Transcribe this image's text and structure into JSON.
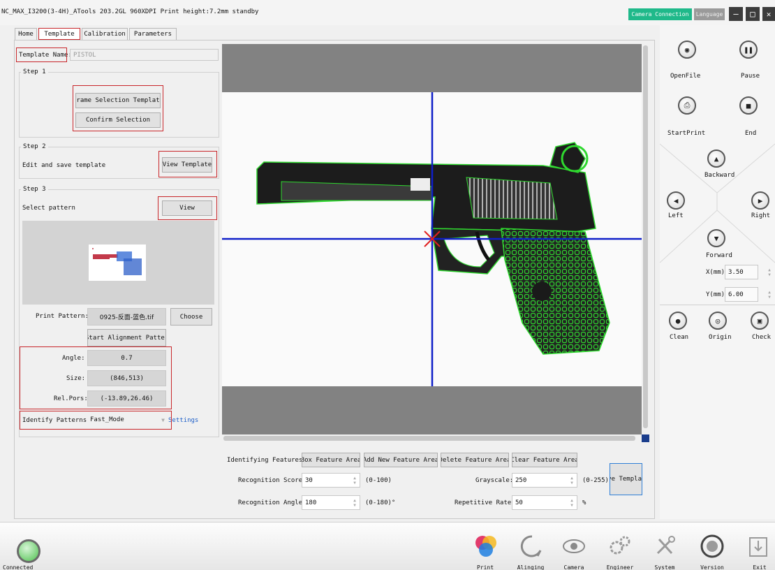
{
  "window": {
    "title": "NC_MAX_I3200(3-4H)_ATools 203.2GL 960XDPI Print height:7.2mm standby",
    "camera_connection": "Camera Connection",
    "language": "Language",
    "minimize": "–",
    "maximize": "□",
    "close": "✕"
  },
  "tabs": [
    "Home",
    "Template",
    "Calibration",
    "Parameters"
  ],
  "left": {
    "template_name_label": "Template Name:",
    "template_name_value": "PISTOL",
    "step1_title": "Step 1",
    "frame_selection_button": "Frame Selection Template",
    "confirm_selection_button": "Confirm Selection",
    "step2_title": "Step 2",
    "step2_text": "Edit and save template",
    "view_template_button": "View Template",
    "step3_title": "Step 3",
    "select_pattern_label": "Select pattern",
    "view_button": "View",
    "print_pattern_label": "Print Pattern:",
    "print_pattern_value": "0925-反面-蓝色.tif",
    "choose_button": "Choose",
    "start_alignment_button": "Start Alignment Pattern",
    "angle_label": "Angle:",
    "angle_value": "0.7",
    "size_label": "Size:",
    "size_value": "(846,513)",
    "relpos_label": "Rel.Pors:",
    "relpos_value": "(-13.89,26.46)",
    "identify_label": "Identify Patterns:",
    "identify_value": "Fast_Mode",
    "settings_link": "Settings"
  },
  "bottom_form": {
    "identifying_features_label": "Identifying Features:",
    "box_feature_button": "Box Feature Area",
    "add_feature_button": "Add New Feature Area",
    "delete_feature_button": "Delete Feature Area",
    "clear_feature_button": "Clear Feature Area",
    "recognition_score_label": "Recognition Score:",
    "recognition_score_value": "30",
    "recognition_score_range": "(0-100)",
    "grayscale_label": "Grayscale:",
    "grayscale_value": "250",
    "grayscale_range": "(0-255)",
    "save_template_button": "ve Templa",
    "recognition_angle_label": "Recognition Angle:",
    "recognition_angle_value": "180",
    "recognition_angle_range": "(0-180)°",
    "repetitive_rate_label": "Repetitive Rate:",
    "repetitive_rate_value": "50",
    "repetitive_rate_unit": "%"
  },
  "right_panel": {
    "openfile": "OpenFile",
    "pause": "Pause",
    "startprint": "StartPrint",
    "end": "End",
    "backward": "Backward",
    "left": "Left",
    "right": "Right",
    "forward": "Forward",
    "x_label": "X(mm)",
    "x_value": "3.50",
    "y_label": "Y(mm)",
    "y_value": "6.00",
    "clean": "Clean",
    "origin": "Origin",
    "check": "Check"
  },
  "bottom_bar": {
    "connected": "Connected",
    "print": "Print",
    "alinging": "Alinging",
    "camera": "Camera",
    "engineer": "Engineer",
    "system": "System",
    "version": "Version",
    "exit": "Exit"
  }
}
